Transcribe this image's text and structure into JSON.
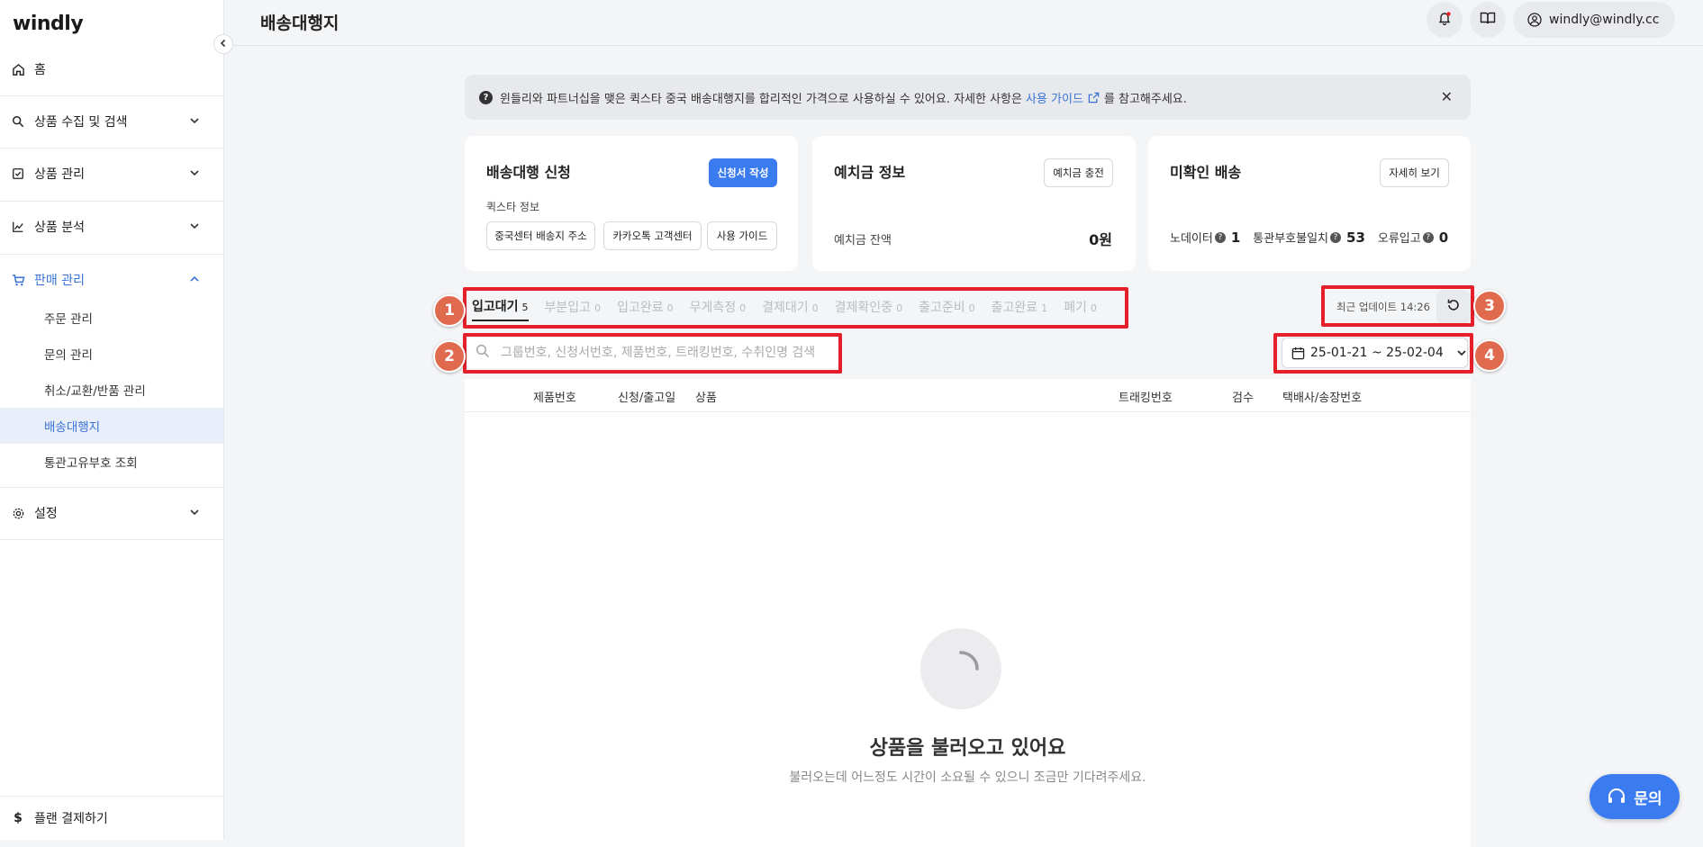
{
  "app": {
    "logo": "windly"
  },
  "sidebar": {
    "items": [
      {
        "label": "홈"
      },
      {
        "label": "상품 수집 및 검색"
      },
      {
        "label": "상품 관리"
      },
      {
        "label": "상품 분석"
      },
      {
        "label": "판매 관리"
      },
      {
        "label": "설정"
      }
    ],
    "sub_items": [
      {
        "label": "주문 관리"
      },
      {
        "label": "문의 관리"
      },
      {
        "label": "취소/교환/반품 관리"
      },
      {
        "label": "배송대행지"
      },
      {
        "label": "통관고유부호 조회"
      }
    ],
    "bottom": {
      "label": "플랜 결제하기"
    }
  },
  "header": {
    "title": "배송대행지",
    "user": "windly@windly.cc"
  },
  "banner": {
    "text_before": "윈들리와 파트너십을 맺은 퀵스타 중국 배송대행지를 합리적인 가격으로 사용하실 수 있어요. 자세한 사항은",
    "link": "사용 가이드",
    "text_after": "를 참고해주세요."
  },
  "cards": {
    "apply": {
      "title": "배송대행 신청",
      "button": "신청서 작성",
      "sub_label": "퀵스타 정보",
      "buttons": [
        "중국센터 배송지 주소",
        "카카오톡 고객센터",
        "사용 가이드"
      ]
    },
    "deposit": {
      "title": "예치금 정보",
      "button": "예치금 충전",
      "label": "예치금 잔액",
      "value": "0원"
    },
    "unconfirmed": {
      "title": "미확인 배송",
      "button": "자세히 보기",
      "metrics": [
        {
          "label": "노데이터",
          "value": "1"
        },
        {
          "label": "통관부호불일치",
          "value": "53"
        },
        {
          "label": "오류입고",
          "value": "0"
        }
      ]
    }
  },
  "tabs": [
    {
      "label": "입고대기",
      "count": "5"
    },
    {
      "label": "부분입고",
      "count": "0"
    },
    {
      "label": "입고완료",
      "count": "0"
    },
    {
      "label": "무게측정",
      "count": "0"
    },
    {
      "label": "결제대기",
      "count": "0"
    },
    {
      "label": "결제확인중",
      "count": "0"
    },
    {
      "label": "출고준비",
      "count": "0"
    },
    {
      "label": "출고완료",
      "count": "1"
    },
    {
      "label": "폐기",
      "count": "0"
    }
  ],
  "update": {
    "label": "최근 업데이트 14:26"
  },
  "search": {
    "placeholder": "그룹번호, 신청서번호, 제품번호, 트래킹번호, 수취인명 검색"
  },
  "date_range": {
    "value": "25-01-21 ~ 25-02-04"
  },
  "table": {
    "headers": [
      "제품번호",
      "신청/출고일",
      "상품",
      "트래킹번호",
      "검수",
      "택배사/송장번호"
    ]
  },
  "loading": {
    "title": "상품을 불러오고 있어요",
    "subtitle": "불러오는데 어느정도 시간이 소요될 수 있으니 조금만 기다려주세요."
  },
  "annotations": [
    "1",
    "2",
    "3",
    "4"
  ],
  "fab": {
    "label": "문의"
  },
  "colors": {
    "accent": "#3a7cf0",
    "annotation": "#e5202a",
    "annotation_badge": "#e06a4e"
  }
}
